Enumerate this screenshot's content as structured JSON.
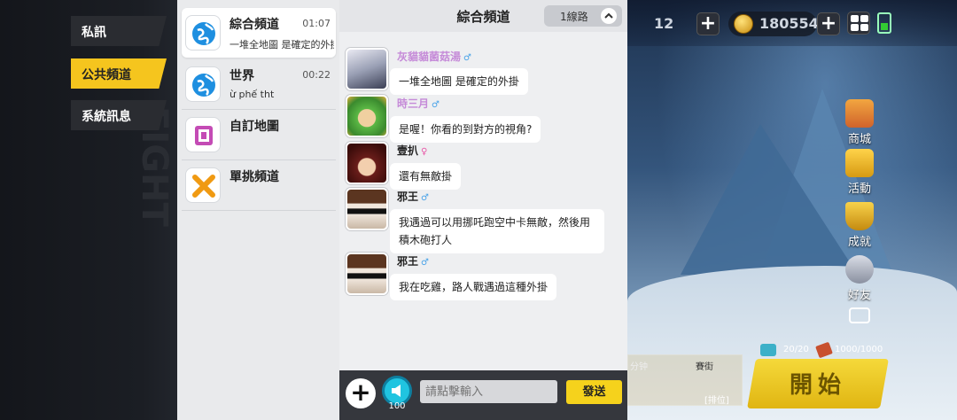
{
  "rail": {
    "tabs": [
      {
        "label": "私訊",
        "active": false
      },
      {
        "label": "公共頻道",
        "active": true
      },
      {
        "label": "系統訊息",
        "active": false
      }
    ]
  },
  "channels": [
    {
      "title": "綜合頻道",
      "time": "01:07",
      "preview": "一堆全地圖 是確定的外掛",
      "icon": "globe-icon",
      "active": true
    },
    {
      "title": "世界",
      "time": "00:22",
      "preview": "ừ phế tht",
      "icon": "globe-icon",
      "active": false
    },
    {
      "title": "自訂地圖",
      "time": "",
      "preview": "",
      "icon": "custom-map-icon",
      "active": false
    },
    {
      "title": "單挑頻道",
      "time": "",
      "preview": "",
      "icon": "crossed-swords-icon",
      "active": false
    }
  ],
  "chat": {
    "title": "綜合頻道",
    "line_select": "1線路",
    "messages": [
      {
        "name": "灰貓貓菌菇湯",
        "gender": "♂",
        "name_color": "#c58ad8",
        "text": "一堆全地圖 是確定的外掛"
      },
      {
        "name": "時三月",
        "gender": "♂",
        "name_color": "#c58ad8",
        "text": "是喔！你看的到對方的視角?"
      },
      {
        "name": "壹扒",
        "gender": "♀",
        "name_color": "#222222",
        "text": "還有無敵掛"
      },
      {
        "name": "邪王",
        "gender": "♂",
        "name_color": "#222222",
        "text": "我遇過可以用挪吒跑空中卡無敵，然後用積木砲打人"
      },
      {
        "name": "邪王",
        "gender": "♂",
        "name_color": "#222222",
        "text": "我在吃雞，路人戰遇過這種外掛"
      }
    ],
    "input_placeholder": "請點擊輸入",
    "send_label": "發送",
    "horn_count": "100"
  },
  "hud": {
    "level": "12",
    "coins": "180554",
    "start_label": "開始",
    "side_buttons": [
      "商城",
      "活動",
      "成就",
      "好友"
    ],
    "energy": "20/20",
    "tickets": "1000/1000",
    "mode_left": "分钟",
    "mode_right": "賽街",
    "mode_bottom": "[排位]"
  },
  "colors": {
    "accent": "#f5c51e",
    "send": "#f5d21c",
    "male": "#4aa3e8",
    "female": "#e85aa8"
  }
}
